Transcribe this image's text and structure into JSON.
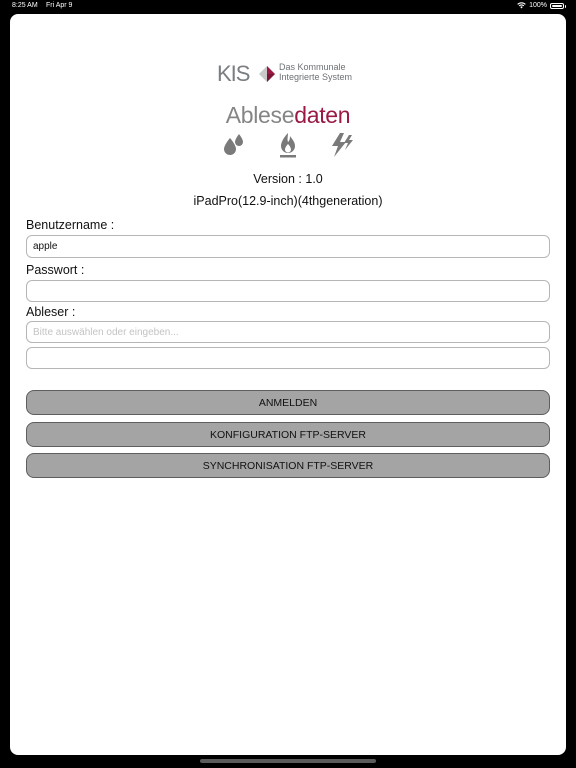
{
  "status_bar": {
    "time": "8:25 AM",
    "date": "Fri Apr 9",
    "battery": "100%",
    "battery_level": 1.0
  },
  "logo": {
    "brand": "KIS",
    "tagline_line1": "Das Kommunale",
    "tagline_line2": "Integrierte System"
  },
  "product": {
    "title_part1": "Ablese",
    "title_part2": "daten",
    "icons": [
      "water-drops-icon",
      "gas-flame-icon",
      "electricity-icon"
    ]
  },
  "info": {
    "version": "Version : 1.0",
    "device": "iPadPro(12.9-inch)(4thgeneration)"
  },
  "form": {
    "username_label": "Benutzername :",
    "username_value": "apple",
    "password_label": "Passwort :",
    "password_value": "",
    "reader_label": "Ableser :",
    "reader_placeholder": "Bitte auswählen oder eingeben...",
    "reader_value": "",
    "extra_value": ""
  },
  "buttons": {
    "login": "ANMELDEN",
    "config": "KONFIGURATION FTP-SERVER",
    "sync": "SYNCHRONISATION FTP-SERVER"
  },
  "colors": {
    "brand_red": "#9a1a44",
    "brand_grey": "#858585",
    "button_bg": "#a4a4a4"
  }
}
